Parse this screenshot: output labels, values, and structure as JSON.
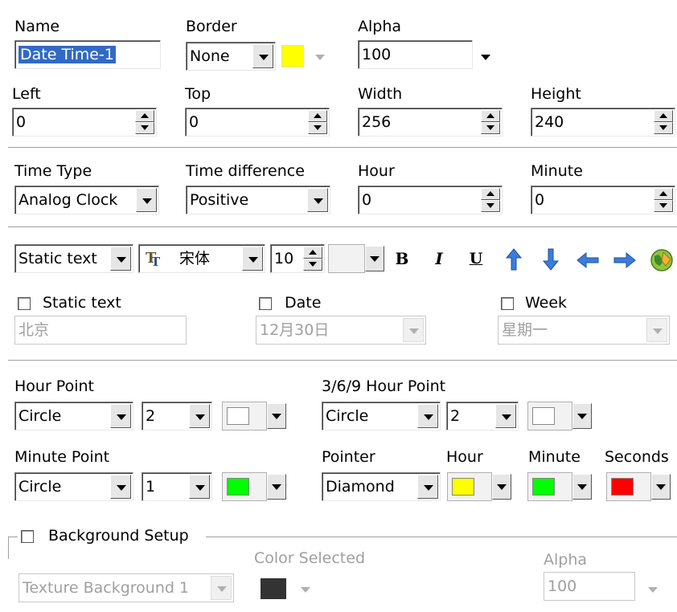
{
  "general": {
    "name_label": "Name",
    "name_value": "Date Time-1",
    "border_label": "Border",
    "border_value": "None",
    "border_color": "#ffff00",
    "alpha_label": "Alpha",
    "alpha_value": "100",
    "left_label": "Left",
    "left_value": "0",
    "top_label": "Top",
    "top_value": "0",
    "width_label": "Width",
    "width_value": "256",
    "height_label": "Height",
    "height_value": "240"
  },
  "time": {
    "type_label": "Time Type",
    "type_value": "Analog Clock",
    "diff_label": "Time difference",
    "diff_value": "Positive",
    "hour_label": "Hour",
    "hour_value": "0",
    "minute_label": "Minute",
    "minute_value": "0"
  },
  "text_toolbar": {
    "mode_value": "Static text",
    "font_icon": "truetype-font-icon",
    "font_value": "宋体",
    "size_value": "10",
    "bold": "B",
    "italic": "I",
    "underline": "U",
    "icons": [
      "arrow-up-icon",
      "arrow-down-icon",
      "arrow-left-icon",
      "arrow-right-icon",
      "globe-icon"
    ]
  },
  "text_fields": {
    "static_label": "Static text",
    "static_value": "北京",
    "date_label": "Date",
    "date_value": "12月30日",
    "week_label": "Week",
    "week_value": "星期一"
  },
  "points": {
    "hour_point_label": "Hour Point",
    "hour_point_shape": "Circle",
    "hour_point_size": "2",
    "hour_point_color": "#ffffff",
    "hour369_label": "3/6/9 Hour Point",
    "hour369_shape": "Circle",
    "hour369_size": "2",
    "hour369_color": "#ffffff",
    "minute_point_label": "Minute Point",
    "minute_point_shape": "Circle",
    "minute_point_size": "1",
    "minute_point_color": "#00ff00",
    "pointer_label": "Pointer",
    "pointer_value": "Diamond",
    "hour_label": "Hour",
    "hour_color": "#ffff00",
    "minute_label": "Minute",
    "minute_color": "#00ff00",
    "seconds_label": "Seconds",
    "seconds_color": "#ff0000"
  },
  "background": {
    "setup_label": "Background Setup",
    "texture_value": "Texture Background 1",
    "color_label": "Color Selected",
    "color_value": "#333333",
    "alpha_label": "Alpha",
    "alpha_value": "100"
  }
}
